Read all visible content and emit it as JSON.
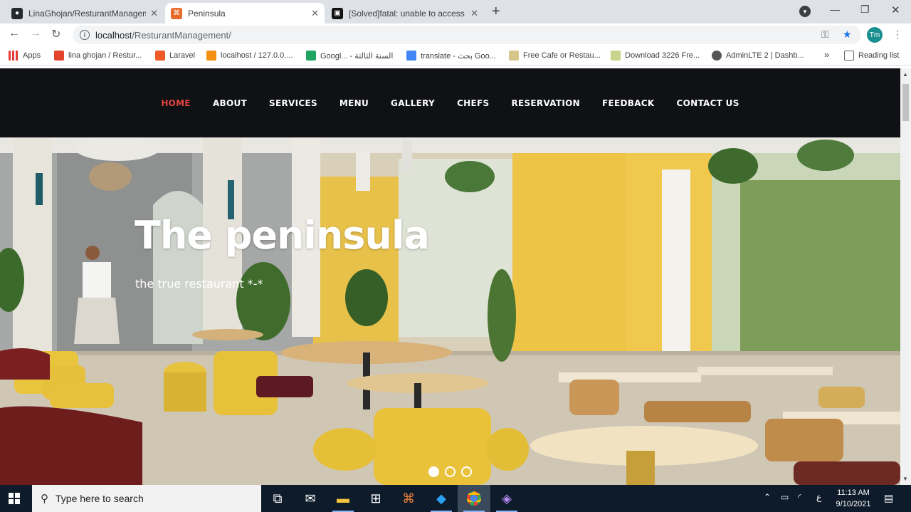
{
  "browser": {
    "tabs": [
      {
        "title": "LinaGhojan/ResturantManageme",
        "active": false
      },
      {
        "title": "Peninsula",
        "active": true
      },
      {
        "title": "[Solved]fatal: unable to access : C",
        "active": false
      }
    ],
    "new_tab": "+",
    "address": {
      "host": "localhost",
      "path": "/ResturantManagement/"
    },
    "avatar_initials": "Tm",
    "bookmarks": [
      {
        "label": "Apps",
        "color": "#e53935"
      },
      {
        "label": "lina ghojan / Restur...",
        "color": "#e2432a"
      },
      {
        "label": "Laravel",
        "color": "#f05a28"
      },
      {
        "label": "localhost / 127.0.0....",
        "color": "#f29111"
      },
      {
        "label": "Googl... - السنة الثالثة",
        "color": "#1fa463"
      },
      {
        "label": "translate - بحث Goo...",
        "color": "#4285f4"
      },
      {
        "label": "Free Cafe or Restau...",
        "color": "#d6c68a"
      },
      {
        "label": "Download 3226 Fre...",
        "color": "#c8d38b"
      },
      {
        "label": "AdminLTE 2 | Dashb...",
        "color": "#555555"
      }
    ],
    "bookmarks_more": "»",
    "reading_list": "Reading list"
  },
  "site": {
    "nav": [
      {
        "label": "HOME",
        "active": true
      },
      {
        "label": "ABOUT",
        "active": false
      },
      {
        "label": "SERVICES",
        "active": false
      },
      {
        "label": "MENU",
        "active": false
      },
      {
        "label": "GALLERY",
        "active": false
      },
      {
        "label": "CHEFS",
        "active": false
      },
      {
        "label": "RESERVATION",
        "active": false
      },
      {
        "label": "FEEDBACK",
        "active": false
      },
      {
        "label": "CONTACT US",
        "active": false
      }
    ],
    "hero": {
      "title": "The peninsula",
      "subtitle": "the true restaurant *-*",
      "slides": 3,
      "active_slide": 0
    },
    "colors": {
      "accent": "#e3453f",
      "navbar_bg": "#0f1114"
    }
  },
  "taskbar": {
    "search_placeholder": "Type here to search",
    "time": "11:13 AM",
    "date": "9/10/2021",
    "lang": "ع"
  }
}
